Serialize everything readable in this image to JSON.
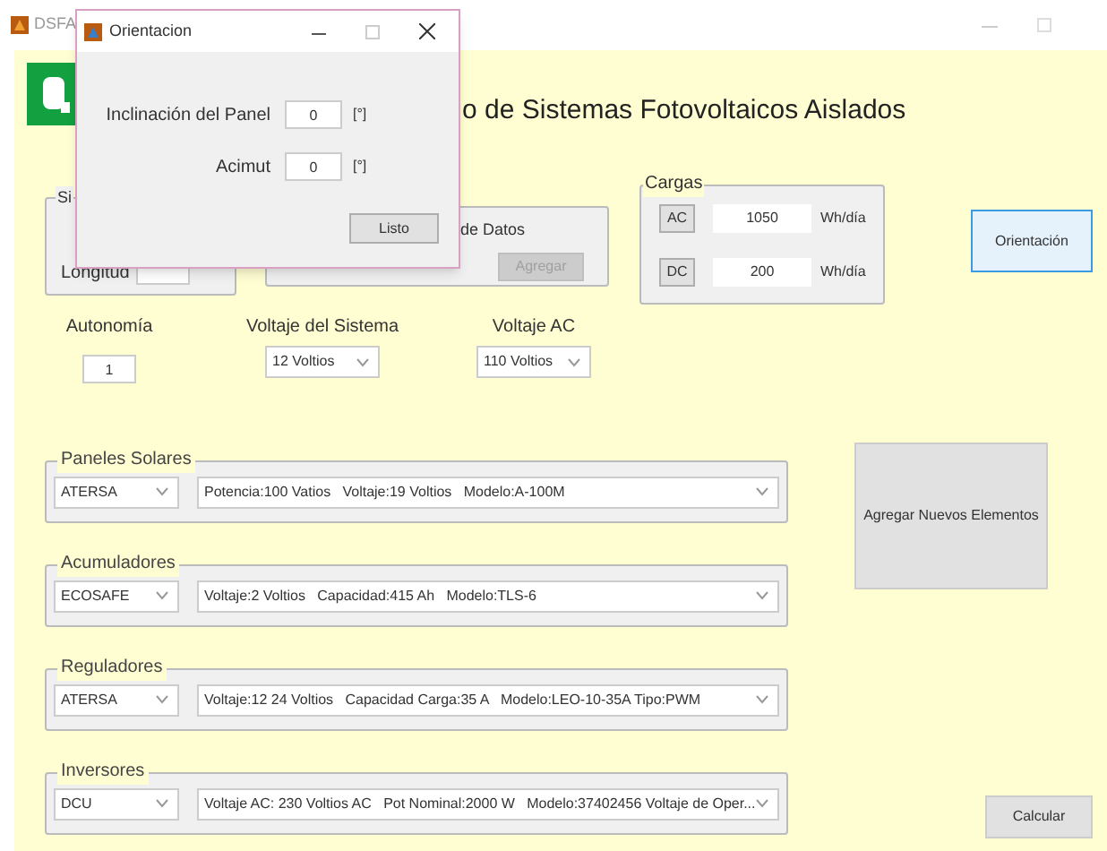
{
  "main_window": {
    "title": "DSFA",
    "heading": "o de Sistemas Fotovoltaicos Aislados"
  },
  "location_group": {
    "title": "Si",
    "label": "Longitud"
  },
  "data_group": {
    "title": "de Datos",
    "button": {
      "label": "Agregar",
      "disabled": true
    }
  },
  "loads_group": {
    "title": "Cargas",
    "rows": [
      {
        "button": "AC",
        "value": "1050",
        "unit": "Wh/día"
      },
      {
        "button": "DC",
        "value": "200",
        "unit": "Wh/día"
      }
    ]
  },
  "orientation_button": "Orientación",
  "autonomy": {
    "label": "Autonomía",
    "value": "1"
  },
  "system_voltage": {
    "label": "Voltaje del Sistema",
    "value": "12 Voltios"
  },
  "ac_voltage": {
    "label": "Voltaje AC",
    "value": "110 Voltios"
  },
  "components": [
    {
      "title": "Paneles Solares",
      "brand": "ATERSA",
      "model": "Potencia:100 Vatios   Voltaje:19 Voltios   Modelo:A-100M"
    },
    {
      "title": "Acumuladores",
      "brand": "ECOSAFE",
      "model": "Voltaje:2 Voltios   Capacidad:415 Ah   Modelo:TLS-6"
    },
    {
      "title": "Reguladores",
      "brand": "ATERSA",
      "model": "Voltaje:12 24 Voltios   Capacidad Carga:35 A   Modelo:LEO-10-35A Tipo:PWM"
    },
    {
      "title": "Inversores",
      "brand": "DCU",
      "model": "Voltaje AC: 230 Voltios AC   Pot Nominal:2000 W   Modelo:37402456 Voltaje de Oper..."
    }
  ],
  "add_button": "Agregar Nuevos Elementos",
  "calculate_button": "Calcular",
  "dialog": {
    "title": "Orientacion",
    "fields": [
      {
        "label": "Inclinación del Panel",
        "value": "0",
        "unit": "[°]"
      },
      {
        "label": "Acimut",
        "value": "0",
        "unit": "[°]"
      }
    ],
    "button": "Listo"
  }
}
